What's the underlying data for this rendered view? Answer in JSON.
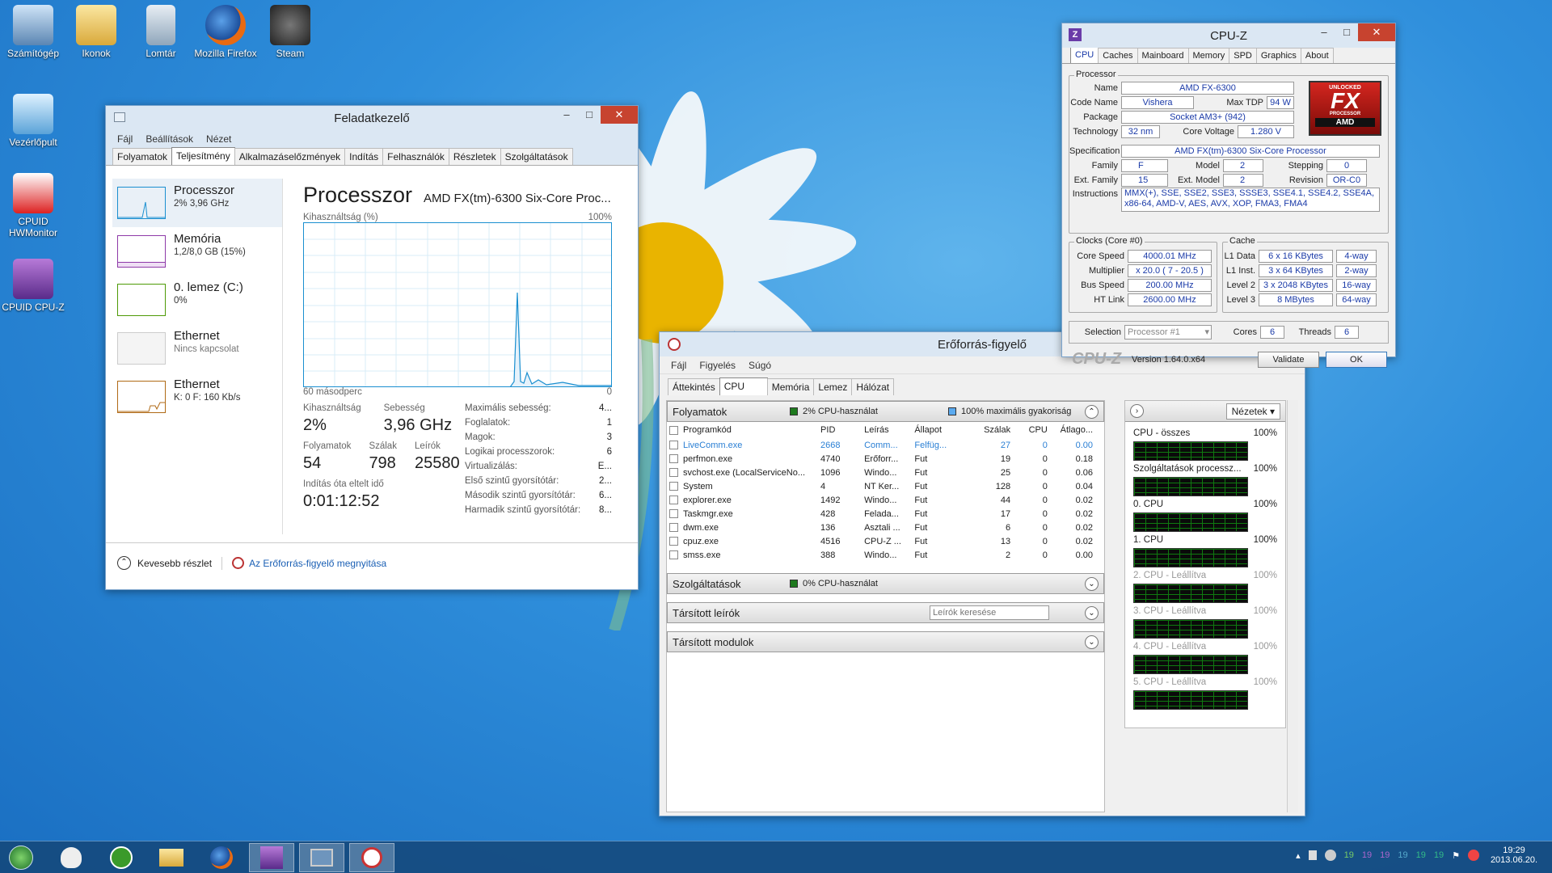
{
  "desktop_icons": [
    {
      "label": "Számítógép"
    },
    {
      "label": "Ikonok"
    },
    {
      "label": "Lomtár"
    },
    {
      "label": "Mozilla Firefox"
    },
    {
      "label": "Steam"
    },
    {
      "label": "Vezérlőpult"
    },
    {
      "label": "CPUID HWMonitor"
    },
    {
      "label": "CPUID CPU-Z"
    }
  ],
  "taskmgr": {
    "title": "Feladatkezelő",
    "menu": [
      "Fájl",
      "Beállítások",
      "Nézet"
    ],
    "tabs": [
      "Folyamatok",
      "Teljesítmény",
      "Alkalmazáselőzmények",
      "Indítás",
      "Felhasználók",
      "Részletek",
      "Szolgáltatások"
    ],
    "sidebar": [
      {
        "name": "Processzor",
        "sub": "2% 3,96 GHz"
      },
      {
        "name": "Memória",
        "sub": "1,2/8,0 GB (15%)"
      },
      {
        "name": "0. lemez (C:)",
        "sub": "0%"
      },
      {
        "name": "Ethernet",
        "sub": "Nincs kapcsolat"
      },
      {
        "name": "Ethernet",
        "sub": "K: 0 F: 160 Kb/s"
      }
    ],
    "heading": "Processzor",
    "cpu_name": "AMD FX(tm)-6300 Six-Core Proc...",
    "graph_label": "Kihasználtság (%)",
    "graph_max": "100%",
    "graph_time": "60 másodperc",
    "graph_min": "0",
    "util_label": "Kihasználtság",
    "util": "2%",
    "speed_label": "Sebesség",
    "speed": "3,96 GHz",
    "proc_label": "Folyamatok",
    "proc": "54",
    "threads_label": "Szálak",
    "threads": "798",
    "handles_label": "Leírók",
    "handles": "25580",
    "uptime_label": "Indítás óta eltelt idő",
    "uptime": "0:01:12:52",
    "specs": [
      {
        "k": "Maximális sebesség:",
        "v": "4..."
      },
      {
        "k": "Foglalatok:",
        "v": "1"
      },
      {
        "k": "Magok:",
        "v": "3"
      },
      {
        "k": "Logikai processzorok:",
        "v": "6"
      },
      {
        "k": "Virtualizálás:",
        "v": "E..."
      },
      {
        "k": "Első szintű gyorsítótár:",
        "v": "2..."
      },
      {
        "k": "Második szintű gyorsítótár:",
        "v": "6..."
      },
      {
        "k": "Harmadik szintű gyorsítótár:",
        "v": "8..."
      }
    ],
    "less": "Kevesebb részlet",
    "open_resmon": "Az Erőforrás-figyelő megnyitása"
  },
  "cpuz": {
    "title": "CPU-Z",
    "tabs": [
      "CPU",
      "Caches",
      "Mainboard",
      "Memory",
      "SPD",
      "Graphics",
      "About"
    ],
    "proc_group": "Processor",
    "name_l": "Name",
    "name": "AMD FX-6300",
    "code_l": "Code Name",
    "code": "Vishera",
    "tdp_l": "Max TDP",
    "tdp": "94 W",
    "pkg_l": "Package",
    "pkg": "Socket AM3+ (942)",
    "tech_l": "Technology",
    "tech": "32 nm",
    "volt_l": "Core Voltage",
    "volt": "1.280 V",
    "spec_l": "Specification",
    "spec": "AMD FX(tm)-6300 Six-Core Processor",
    "fam_l": "Family",
    "fam": "F",
    "model_l": "Model",
    "model": "2",
    "step_l": "Stepping",
    "step": "0",
    "efam_l": "Ext. Family",
    "efam": "15",
    "emodel_l": "Ext. Model",
    "emodel": "2",
    "rev_l": "Revision",
    "rev": "OR-C0",
    "instr_l": "Instructions",
    "instr1": "MMX(+), SSE, SSE2, SSE3, SSSE3, SSE4.1, SSE4.2, SSE4A,",
    "instr2": "x86-64, AMD-V, AES, AVX, XOP, FMA3, FMA4",
    "clocks_group": "Clocks (Core #0)",
    "cs_l": "Core Speed",
    "cs": "4000.01 MHz",
    "mul_l": "Multiplier",
    "mul": "x 20.0 ( 7 - 20.5 )",
    "bus_l": "Bus Speed",
    "bus": "200.00 MHz",
    "ht_l": "HT Link",
    "ht": "2600.00 MHz",
    "cache_group": "Cache",
    "l1d_l": "L1 Data",
    "l1d": "6 x 16 KBytes",
    "l1d_w": "4-way",
    "l1i_l": "L1 Inst.",
    "l1i": "3 x 64 KBytes",
    "l1i_w": "2-way",
    "l2_l": "Level 2",
    "l2": "3 x 2048 KBytes",
    "l2_w": "16-way",
    "l3_l": "Level 3",
    "l3": "8 MBytes",
    "l3_w": "64-way",
    "sel_l": "Selection",
    "sel": "Processor #1",
    "cores_l": "Cores",
    "cores": "6",
    "thr_l": "Threads",
    "thr": "6",
    "brand": "CPU-Z",
    "version": "Version 1.64.0.x64",
    "validate": "Validate",
    "ok": "OK",
    "logo_top": "UNLOCKED",
    "logo_fx": "FX",
    "logo_sub": "PROCESSOR",
    "logo_amd": "AMD"
  },
  "resmon": {
    "title": "Erőforrás-figyelő",
    "menu": [
      "Fájl",
      "Figyelés",
      "Súgó"
    ],
    "tabs": [
      "Áttekintés",
      "CPU",
      "Memória",
      "Lemez",
      "Hálózat"
    ],
    "proc_sec": "Folyamatok",
    "cpu_use": "2% CPU-használat",
    "max_freq": "100% maximális gyakoriság",
    "cols": [
      "Programkód",
      "PID",
      "Leírás",
      "Állapot",
      "Szálak",
      "CPU",
      "Átlago..."
    ],
    "rows": [
      [
        "LiveComm.exe",
        "2668",
        "Comm...",
        "Felfüg...",
        "27",
        "0",
        "0.00"
      ],
      [
        "perfmon.exe",
        "4740",
        "Erőforr...",
        "Fut",
        "19",
        "0",
        "0.18"
      ],
      [
        "svchost.exe (LocalServiceNo...",
        "1096",
        "Windo...",
        "Fut",
        "25",
        "0",
        "0.06"
      ],
      [
        "System",
        "4",
        "NT Ker...",
        "Fut",
        "128",
        "0",
        "0.04"
      ],
      [
        "explorer.exe",
        "1492",
        "Windo...",
        "Fut",
        "44",
        "0",
        "0.02"
      ],
      [
        "Taskmgr.exe",
        "428",
        "Felada...",
        "Fut",
        "17",
        "0",
        "0.02"
      ],
      [
        "dwm.exe",
        "136",
        "Asztali ...",
        "Fut",
        "6",
        "0",
        "0.02"
      ],
      [
        "cpuz.exe",
        "4516",
        "CPU-Z ...",
        "Fut",
        "13",
        "0",
        "0.02"
      ],
      [
        "smss.exe",
        "388",
        "Windo...",
        "Fut",
        "2",
        "0",
        "0.00"
      ]
    ],
    "svc_sec": "Szolgáltatások",
    "svc_use": "0% CPU-használat",
    "handles_sec": "Társított leírók",
    "search_ph": "Leírók keresése",
    "modules_sec": "Társított modulok",
    "views": "Nézetek",
    "graphs": [
      {
        "l": "CPU - összes",
        "r": "100%"
      },
      {
        "l": "Szolgáltatások processz...",
        "r": "100%"
      },
      {
        "l": "0. CPU",
        "r": "100%"
      },
      {
        "l": "1. CPU",
        "r": "100%"
      },
      {
        "l": "2. CPU - Leállítva",
        "r": "100%"
      },
      {
        "l": "3. CPU - Leállítva",
        "r": "100%"
      },
      {
        "l": "4. CPU - Leállítva",
        "r": "100%"
      },
      {
        "l": "5. CPU - Leállítva",
        "r": "100%"
      }
    ]
  },
  "taskbar": {
    "time": "19:29",
    "date": "2013.06.20.",
    "tray_nums": [
      "19",
      "19",
      "19",
      "19",
      "19",
      "19"
    ]
  }
}
